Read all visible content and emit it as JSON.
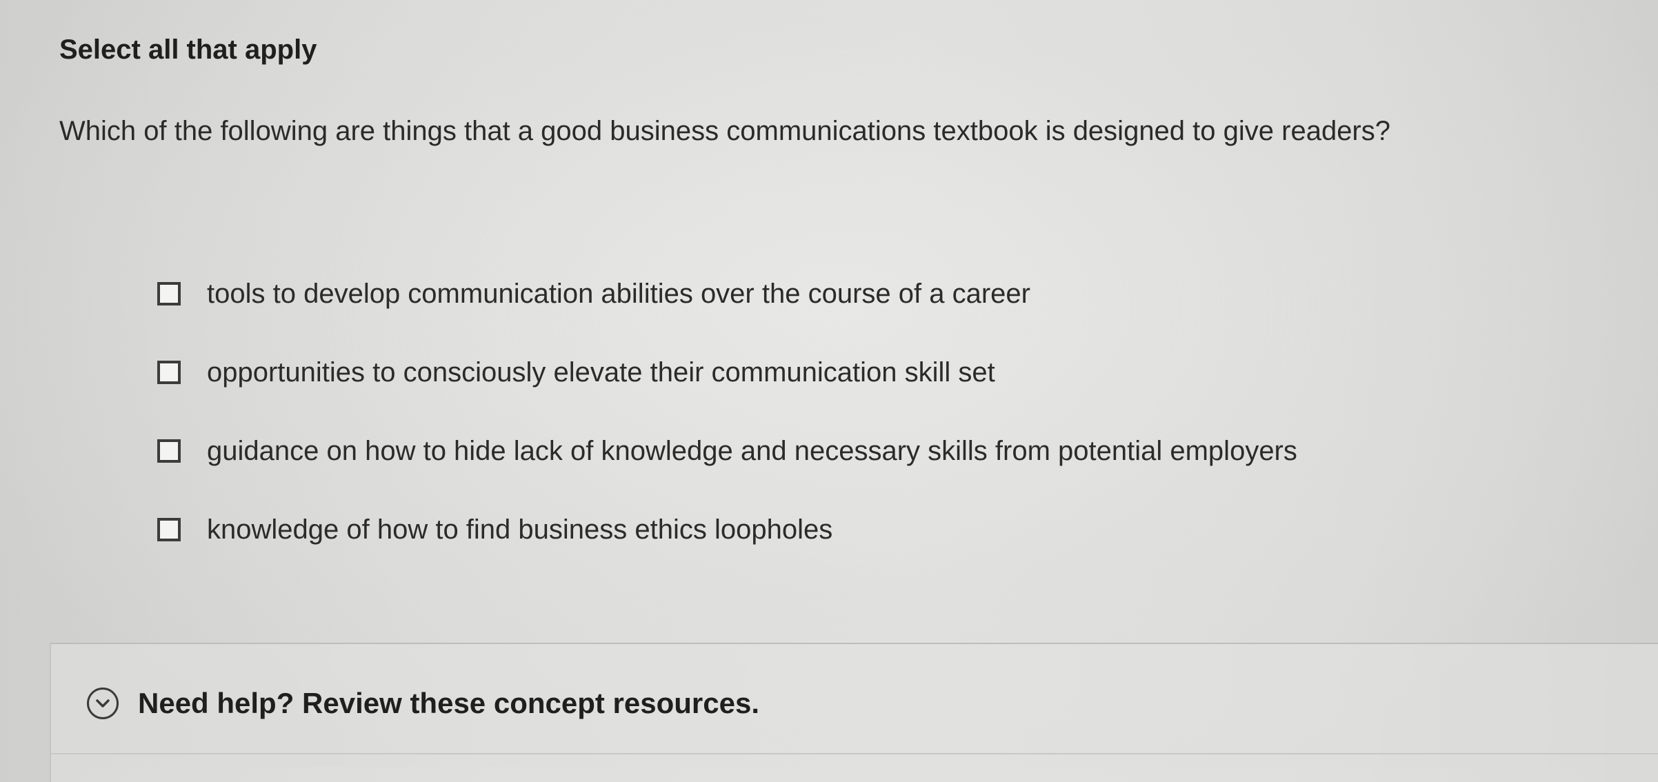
{
  "question": {
    "instruction": "Select all that apply",
    "prompt": "Which of the following are things that a good business communications textbook is designed to give readers?",
    "options": [
      {
        "label": "tools to develop communication abilities over the course of a career",
        "checked": false
      },
      {
        "label": "opportunities to consciously elevate their communication skill set",
        "checked": false
      },
      {
        "label": "guidance on how to hide lack of knowledge and necessary skills from potential employers",
        "checked": false
      },
      {
        "label": "knowledge of how to find business ethics loopholes",
        "checked": false
      }
    ]
  },
  "help": {
    "label": "Need help? Review these concept resources.",
    "icon": "chevron-down-circle-icon"
  }
}
